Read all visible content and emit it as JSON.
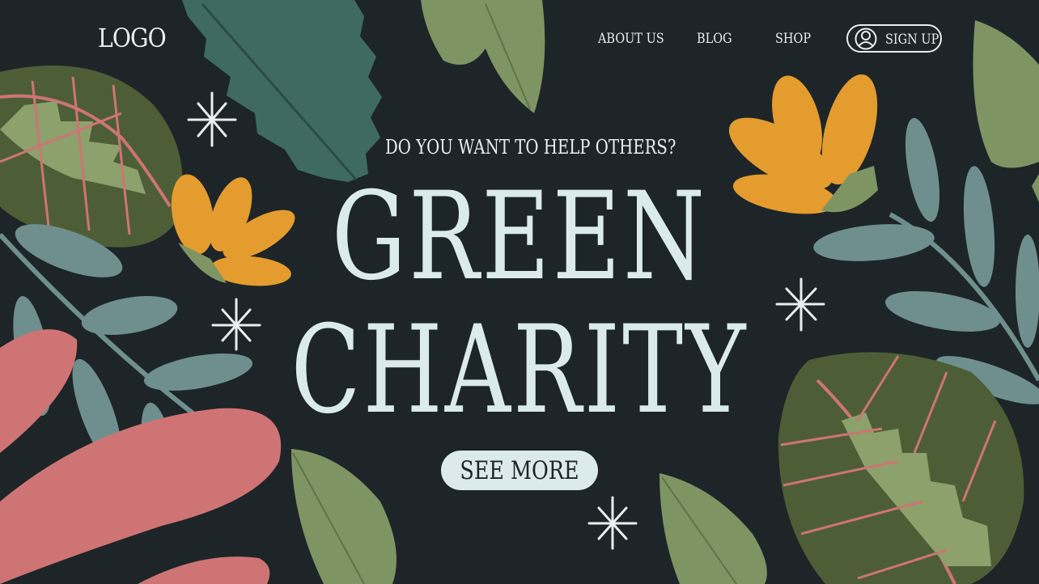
{
  "header": {
    "logo": "LOGO",
    "nav": [
      "ABOUT US",
      "BLOG",
      "SHOP"
    ],
    "signup_label": "SIGN UP",
    "signup_icon": "user-icon"
  },
  "hero": {
    "tagline": "DO YOU WANT TO HELP OTHERS?",
    "title_line1": "GREEN",
    "title_line2": "CHARITY",
    "cta_label": "SEE MORE"
  },
  "colors": {
    "background": "#1d2528",
    "text": "#dbeaea",
    "orange_flower": "#e49c2e",
    "olive_leaf": "#7f9463",
    "teal_leaf": "#3e6a63",
    "blue_leaf": "#6f8f8f",
    "pink_leaf": "#cf7474"
  }
}
